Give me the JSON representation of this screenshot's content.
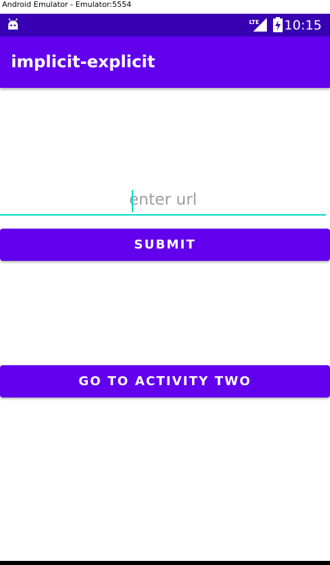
{
  "window": {
    "title": "Android Emulator - Emulator:5554"
  },
  "status_bar": {
    "time": "10:15",
    "network": "LTE",
    "icons": [
      "android-notification-icon",
      "lte-signal-icon",
      "battery-charging-icon"
    ],
    "background": "#3700b3"
  },
  "app_bar": {
    "title": "implicit-explicit",
    "background": "#6200ee"
  },
  "form": {
    "url_placeholder": "enter url",
    "url_value": "",
    "accent": "#03dac5",
    "submit_label": "SUBMIT"
  },
  "navigation": {
    "activity_two_label": "GO TO ACTIVITY TWO"
  }
}
